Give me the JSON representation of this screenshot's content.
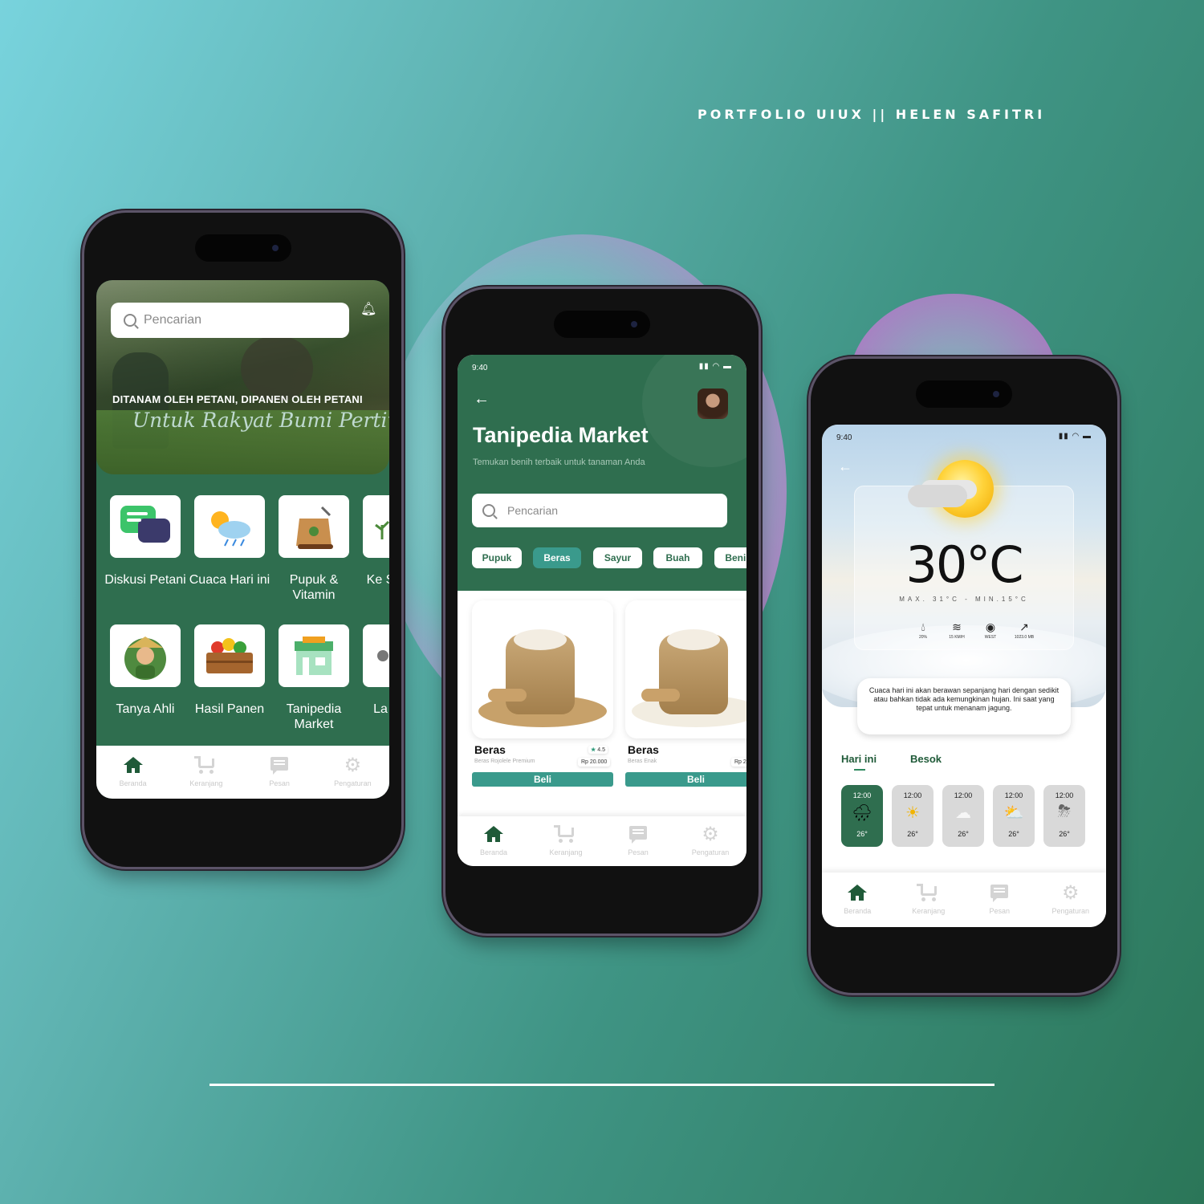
{
  "portfolio": {
    "title": "PORTFOLIO UIUX || HELEN SAFITRI"
  },
  "nav": {
    "home": "Beranda",
    "cart": "Keranjang",
    "messages": "Pesan",
    "settings": "Pengaturan"
  },
  "screen1": {
    "search_placeholder": "Pencarian",
    "hero_line1": "DITANAM OLEH PETANI, DIPANEN OLEH PETANI",
    "hero_line2": "Untuk Rakyat Bumi Pertiwi",
    "menu": [
      {
        "label": "Diskusi Petani",
        "icon": "chat-bubbles-icon"
      },
      {
        "label": "Cuaca Hari ini",
        "icon": "weather-icon"
      },
      {
        "label": "Pupuk & Vitamin",
        "icon": "fertilizer-bag-icon"
      },
      {
        "label": "Ke S",
        "icon": "plant-icon"
      },
      {
        "label": "Tanya Ahli",
        "icon": "farmer-icon"
      },
      {
        "label": "Hasil Panen",
        "icon": "harvest-crate-icon"
      },
      {
        "label": "Tanipedia Market",
        "icon": "market-store-icon"
      },
      {
        "label": "La",
        "icon": "more-icon"
      }
    ]
  },
  "screen2": {
    "time": "9:40",
    "title": "Tanipedia Market",
    "subtitle": "Temukan benih terbaik untuk tanaman Anda",
    "search_placeholder": "Pencarian",
    "chips": [
      "Pupuk",
      "Beras",
      "Sayur",
      "Buah",
      "Benih"
    ],
    "active_chip": "Beras",
    "products": [
      {
        "name": "Beras",
        "desc": "Beras Rojolele Premium",
        "rating": "4.5",
        "price": "Rp 20.000",
        "buy": "Beli"
      },
      {
        "name": "Beras",
        "desc": "Beras Enak",
        "rating": "",
        "price": "Rp 2",
        "buy": "Beli"
      }
    ]
  },
  "screen3": {
    "time": "9:40",
    "temperature": "30°C",
    "max_min": "MAX. 31°C - MIN.15°C",
    "stats": [
      {
        "icon": "humidity-icon",
        "value": "20%"
      },
      {
        "icon": "wind-icon",
        "value": "15 KM/H"
      },
      {
        "icon": "compass-icon",
        "value": "WEST"
      },
      {
        "icon": "pressure-icon",
        "value": "1023.0 MB"
      }
    ],
    "description": "Cuaca hari ini akan berawan sepanjang hari dengan sedikit atau bahkan tidak ada kemungkinan hujan. Ini saat yang tepat untuk menanam jagung.",
    "tab_today": "Hari ini",
    "tab_tomorrow": "Besok",
    "hours": [
      {
        "time": "12:00",
        "temp": "26°",
        "icon": "rain-cloud-icon"
      },
      {
        "time": "12:00",
        "temp": "26°",
        "icon": "sun-icon"
      },
      {
        "time": "12:00",
        "temp": "26°",
        "icon": "cloud-icon"
      },
      {
        "time": "12:00",
        "temp": "26°",
        "icon": "sun-rain-icon"
      },
      {
        "time": "12:00",
        "temp": "26°",
        "icon": "storm-icon"
      }
    ]
  }
}
